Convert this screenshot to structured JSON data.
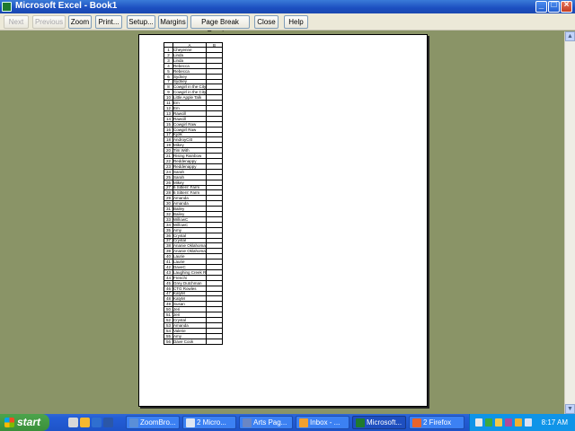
{
  "window": {
    "title": "Microsoft Excel - Book1"
  },
  "toolbar": {
    "buttons": [
      {
        "label": "Next",
        "disabled": true
      },
      {
        "label": "Previous",
        "disabled": true
      },
      {
        "label": "Zoom",
        "disabled": false
      },
      {
        "label": "Print...",
        "disabled": false
      },
      {
        "label": "Setup...",
        "disabled": false
      },
      {
        "label": "Margins",
        "disabled": false
      },
      {
        "label": "Page Break Preview",
        "disabled": false
      },
      {
        "label": "Close",
        "disabled": false
      },
      {
        "label": "Help",
        "disabled": false
      }
    ]
  },
  "sheet": {
    "columns": [
      "A",
      "B"
    ],
    "rows": [
      "Cheyenne",
      "Linda",
      "Linda",
      "Rebecca",
      "Rebecca",
      "Sydney",
      "Sydney",
      "Cowgirl in the City",
      "Cowgirl in the City",
      "Little Apple Talk",
      "Em",
      "Em",
      "Rawcill",
      "Rawcill",
      "Cowgirl Raw",
      "Cowgirl Raw",
      "Kjolk",
      "AndroyCitt",
      "Mikey",
      "Tim With",
      "Rising Rainbow",
      "Reddenappy",
      "Reddenappy",
      "Sarah",
      "Sarah",
      "Mikey",
      "6 Sitters' Farm",
      "6 Sitters' Farm",
      "Amanda",
      "Amanda",
      "Bailey",
      "Bailey",
      "WillowC",
      "WillowC",
      "Amy",
      "Crystal",
      "Crystal",
      "Ananie Oklahoma",
      "Ananie Oklahoma",
      "Laurie",
      "Laurie",
      "DaveC",
      "Laughing Creek Ranch",
      "Frenchi",
      "Grey Dutchman",
      "CTG Rowles",
      "KatyM",
      "KatyM",
      "Susan",
      "Jeri",
      "Jeri",
      "Crystal",
      "Amanda",
      "Valerie",
      "Amy",
      "Dave Cook"
    ]
  },
  "taskbar": {
    "start_label": "start",
    "tasks": [
      {
        "label": "ZoomBro...",
        "color": "#5a8fd8"
      },
      {
        "label": "2 Micro...",
        "color": "#dfe6f2"
      },
      {
        "label": "Arts Pag...",
        "color": "#6a86c4"
      },
      {
        "label": "Inbox - ...",
        "color": "#f0a030"
      },
      {
        "label": "Microsoft...",
        "color": "#1f7a2e",
        "active": true
      },
      {
        "label": "2 Firefox",
        "color": "#e8642c"
      }
    ],
    "clock": "8:17 AM"
  },
  "colors": {
    "desktop_bg": "#8a9467",
    "titlebar": "#1c4fc0",
    "taskbar": "#245ed7"
  }
}
